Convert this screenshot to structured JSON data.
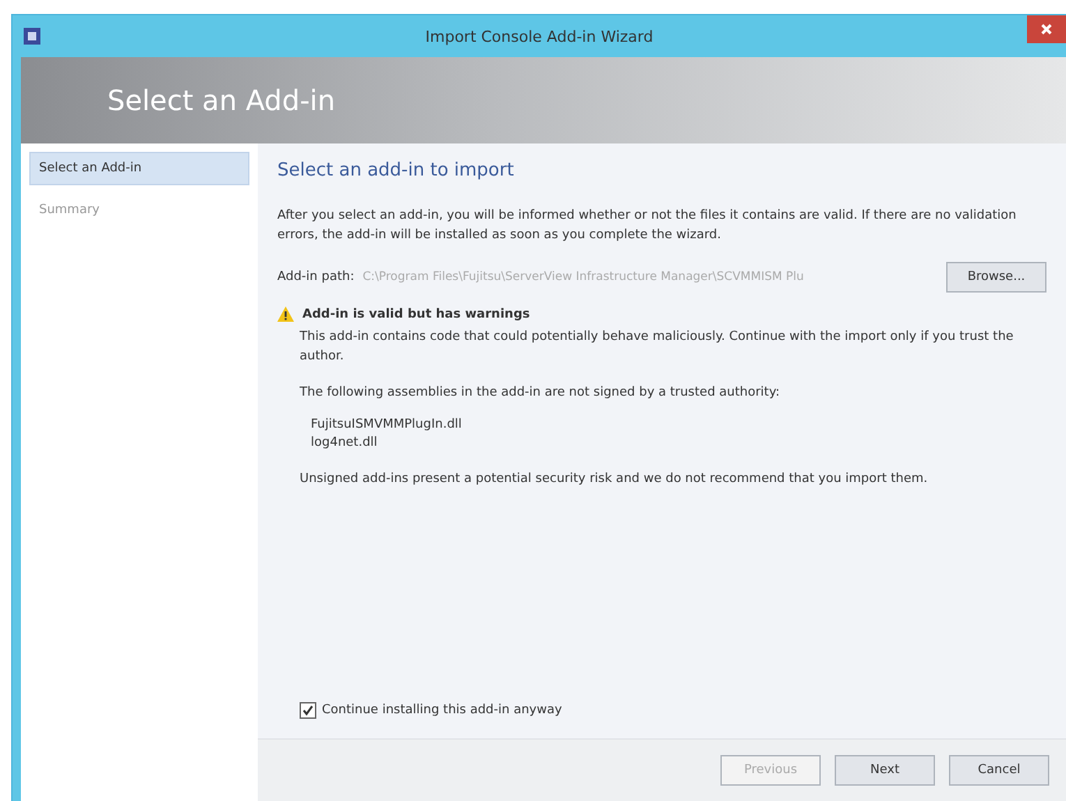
{
  "window": {
    "title": "Import Console Add-in Wizard"
  },
  "header": {
    "title": "Select an Add-in"
  },
  "sidebar": {
    "items": [
      {
        "label": "Select an Add-in",
        "selected": true
      },
      {
        "label": "Summary",
        "selected": false
      }
    ]
  },
  "content": {
    "heading": "Select an add-in to import",
    "intro": "After you select an add-in, you will be informed whether or not the files it contains are valid. If there are no validation errors, the add-in will be installed as soon as you complete the wizard.",
    "path_label": "Add-in path:",
    "path_value": "C:\\Program Files\\Fujitsu\\ServerView Infrastructure Manager\\SCVMMISM Plu",
    "browse": "Browse...",
    "warning_title": "Add-in is valid but has warnings",
    "warning_text": "This add-in contains code that could potentially behave maliciously. Continue with the import only if you trust the author.",
    "assemblies_intro": "The following assemblies in the add-in are not signed by a trusted authority:",
    "assemblies": [
      "FujitsuISMVMMPlugIn.dll",
      "log4net.dll"
    ],
    "risk_text": "Unsigned add-ins present a potential security risk and we do not recommend that you import them.",
    "continue": {
      "label": "Continue installing this add-in anyway",
      "checked": true
    }
  },
  "buttons": [
    {
      "label": "Previous",
      "disabled": true
    },
    {
      "label": "Next",
      "disabled": false
    },
    {
      "label": "Cancel",
      "disabled": false
    }
  ]
}
